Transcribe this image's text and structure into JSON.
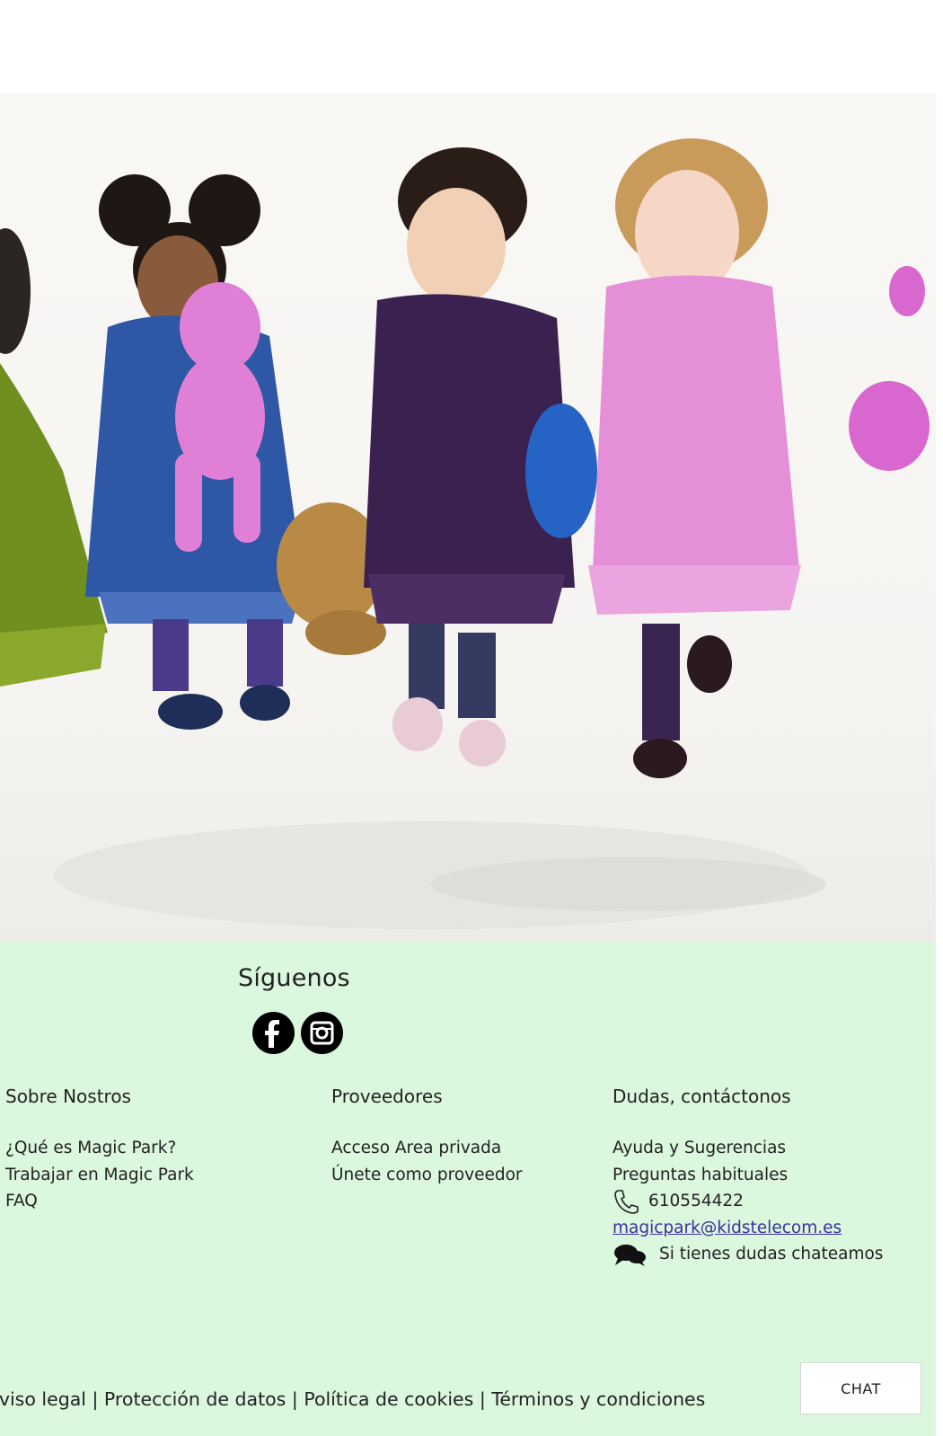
{
  "hero": {
    "image": "kids-walking-with-plush-toys"
  },
  "footer": {
    "follow": {
      "title": "Síguenos",
      "social": [
        {
          "name": "facebook-icon"
        },
        {
          "name": "instagram-icon"
        }
      ]
    },
    "columns": {
      "about": {
        "title": "Sobre Nostros",
        "items": [
          "¿Qué es Magic Park?",
          "Trabajar en Magic Park",
          "FAQ"
        ]
      },
      "providers": {
        "title": "Proveedores",
        "items": [
          "Acceso Area privada",
          "Únete como proveedor"
        ]
      },
      "contact": {
        "title": "Dudas, contáctonos",
        "items": [
          "Ayuda y Sugerencias",
          "Preguntas habituales"
        ],
        "phone": "610554422",
        "email": "magicpark@kidstelecom.es",
        "chat_text": "Si tienes dudas chateamos"
      }
    },
    "legal": {
      "aviso": "Aviso legal",
      "sep": " | ",
      "privacy": "Protección de datos",
      "cookies": "Política de cookies",
      "terms": "Términos y condiciones"
    }
  },
  "chat_button": {
    "label": "CHAT"
  },
  "colors": {
    "footer_bg": "#dbf7dd",
    "link": "#3d2fa0"
  }
}
